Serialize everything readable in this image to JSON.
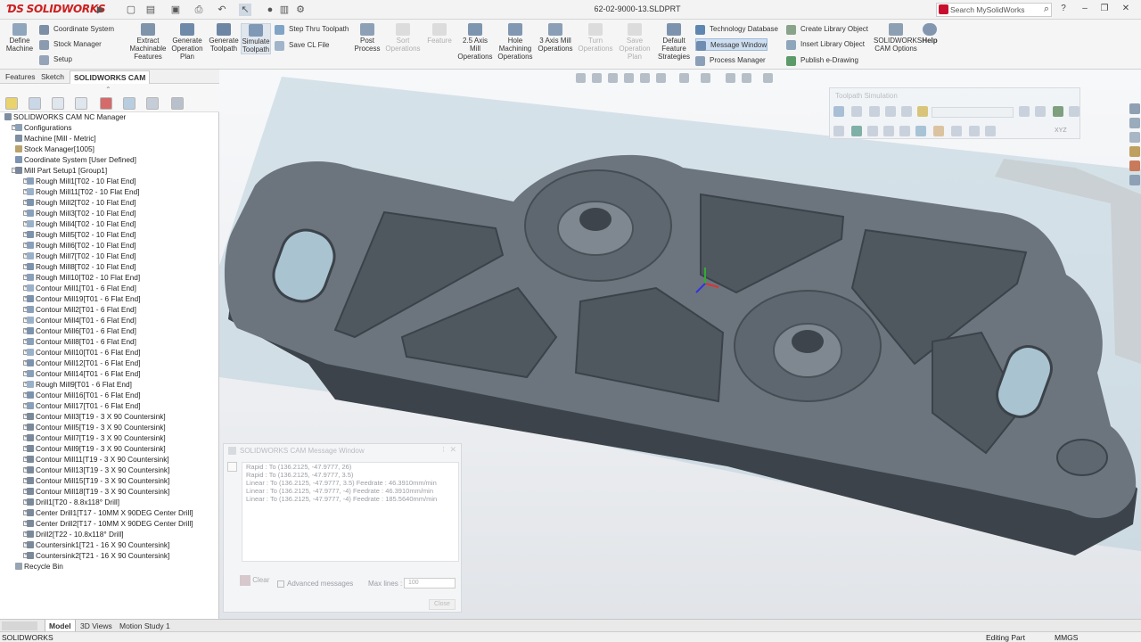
{
  "app": {
    "name": "SOLIDWORKS",
    "document_title": "62-02-9000-13.SLDPRT"
  },
  "search": {
    "placeholder": "Search MySolidWorks"
  },
  "ribbon": {
    "define_machine": "Define Machine",
    "coordinate_system": "Coordinate System",
    "stock_manager": "Stock Manager",
    "setup": "Setup",
    "extract_features": "Extract Machinable Features",
    "generate_plan": "Generate Operation Plan",
    "generate_toolpath": "Generate Toolpath",
    "simulate_toolpath": "Simulate Toolpath",
    "step_thru_toolpath": "Step Thru Toolpath",
    "save_cl_file": "Save CL File",
    "post_process": "Post Process",
    "sort_operations": "Sort Operations",
    "feature": "Feature",
    "mill_25": "2.5 Axis Mill Operations",
    "hole_machining": "Hole Machining Operations",
    "mill_3axis": "3 Axis Mill Operations",
    "turn_operations": "Turn Operations",
    "save_operation_plan": "Save Operation Plan",
    "default_feature_strategies": "Default Feature Strategies",
    "technology_database": "Technology Database",
    "message_window": "Message Window",
    "process_manager": "Process Manager",
    "create_library_object": "Create Library Object",
    "insert_library_object": "Insert Library Object",
    "publish_edrawing": "Publish e-Drawing",
    "cam_options": "SOLIDWORKS CAM Options",
    "help": "Help"
  },
  "fm_tabs": [
    "Features",
    "Sketch",
    "SOLIDWORKS CAM"
  ],
  "tree": {
    "root": "SOLIDWORKS CAM NC Manager",
    "top": [
      "Configurations",
      "Machine [Mill - Metric]",
      "Stock Manager[1005]",
      "Coordinate System [User Defined]",
      "Mill Part Setup1 [Group1]"
    ],
    "operations": [
      "Rough Mill1[T02 - 10 Flat End]",
      "Rough Mill11[T02 - 10 Flat End]",
      "Rough Mill2[T02 - 10 Flat End]",
      "Rough Mill3[T02 - 10 Flat End]",
      "Rough Mill4[T02 - 10 Flat End]",
      "Rough Mill5[T02 - 10 Flat End]",
      "Rough Mill6[T02 - 10 Flat End]",
      "Rough Mill7[T02 - 10 Flat End]",
      "Rough Mill8[T02 - 10 Flat End]",
      "Rough Mill10[T02 - 10 Flat End]",
      "Contour Mill1[T01 - 6 Flat End]",
      "Contour Mill19[T01 - 6 Flat End]",
      "Contour Mill2[T01 - 6 Flat End]",
      "Contour Mill4[T01 - 6 Flat End]",
      "Contour Mill6[T01 - 6 Flat End]",
      "Contour Mill8[T01 - 6 Flat End]",
      "Contour Mill10[T01 - 6 Flat End]",
      "Contour Mill12[T01 - 6 Flat End]",
      "Contour Mill14[T01 - 6 Flat End]",
      "Rough Mill9[T01 - 6 Flat End]",
      "Contour Mill16[T01 - 6 Flat End]",
      "Contour Mill17[T01 - 6 Flat End]",
      "Contour Mill3[T19 - 3 X 90 Countersink]",
      "Contour Mill5[T19 - 3 X 90 Countersink]",
      "Contour Mill7[T19 - 3 X 90 Countersink]",
      "Contour Mill9[T19 - 3 X 90 Countersink]",
      "Contour Mill11[T19 - 3 X 90 Countersink]",
      "Contour Mill13[T19 - 3 X 90 Countersink]",
      "Contour Mill15[T19 - 3 X 90 Countersink]",
      "Contour Mill18[T19 - 3 X 90 Countersink]",
      "Drill1[T20 - 8.8x118° Drill]",
      "Center Drill1[T17 - 10MM X 90DEG Center Drill]",
      "Center Drill2[T17 - 10MM X 90DEG Center Drill]",
      "Drill2[T22 - 10.8x118° Drill]",
      "Countersink1[T21 - 16 X 90 Countersink]",
      "Countersink2[T21 - 16 X 90 Countersink]"
    ],
    "recycle_bin": "Recycle Bin"
  },
  "toolpath_sim": {
    "title": "Toolpath Simulation",
    "axis_label": "XYZ"
  },
  "message_window": {
    "title": "SOLIDWORKS CAM Message Window",
    "lines": [
      "Rapid : To (136.2125, -47.9777, 26)",
      "Rapid : To (136.2125, -47.9777, 3.5)",
      "Linear : To (136.2125, -47.9777, 3.5) Feedrate : 46.3910mm/min",
      "Linear : To (136.2125, -47.9777, -4) Feedrate : 46.3910mm/min",
      "Linear : To (136.2125, -47.9777, -4) Feedrate : 185.5640mm/min"
    ],
    "clear": "Clear",
    "advanced": "Advanced messages",
    "max_lines_label": "Max lines :",
    "max_lines_value": "100",
    "close": "Close"
  },
  "bottom_tabs": [
    "Model",
    "3D Views",
    "Motion Study 1"
  ],
  "status": {
    "app": "SOLIDWORKS",
    "mode": "Editing Part",
    "units": "MMGS"
  },
  "colors": {
    "accent": "#cc1f1f",
    "part": "#5b646d",
    "stock": "#a9c4d0",
    "tool": "#bfc3c6"
  }
}
